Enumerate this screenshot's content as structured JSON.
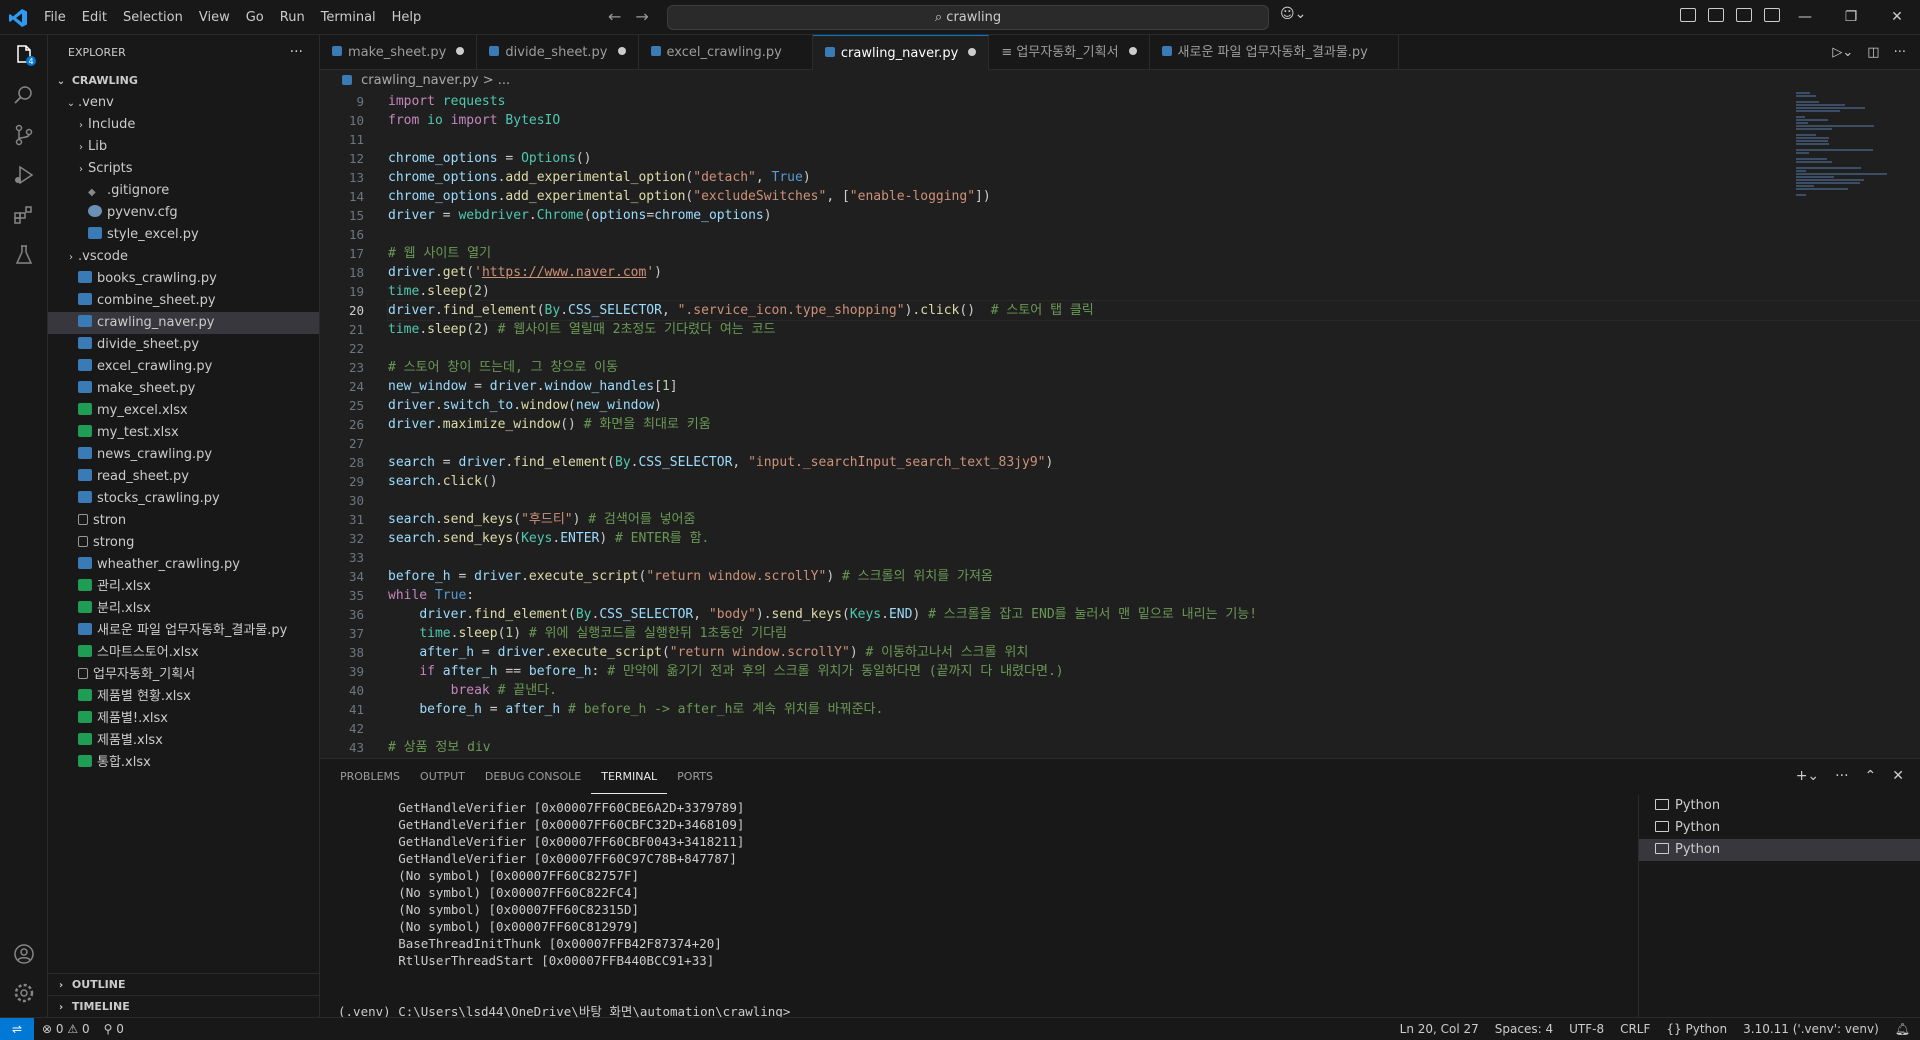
{
  "menus": [
    "File",
    "Edit",
    "Selection",
    "View",
    "Go",
    "Run",
    "Terminal",
    "Help"
  ],
  "search": {
    "text": "crawling"
  },
  "explorer": {
    "title": "EXPLORER",
    "root": "CRAWLING",
    "items": [
      {
        "label": ".venv",
        "kind": "folder-open",
        "depth": 1
      },
      {
        "label": "Include",
        "kind": "folder",
        "depth": 2
      },
      {
        "label": "Lib",
        "kind": "folder",
        "depth": 2
      },
      {
        "label": "Scripts",
        "kind": "folder",
        "depth": 2
      },
      {
        "label": ".gitignore",
        "kind": "git",
        "depth": 2
      },
      {
        "label": "pyvenv.cfg",
        "kind": "cfg",
        "depth": 2
      },
      {
        "label": "style_excel.py",
        "kind": "py",
        "depth": 2
      },
      {
        "label": ".vscode",
        "kind": "folder",
        "depth": 1
      },
      {
        "label": "books_crawling.py",
        "kind": "py",
        "depth": 1
      },
      {
        "label": "combine_sheet.py",
        "kind": "py",
        "depth": 1
      },
      {
        "label": "crawling_naver.py",
        "kind": "py",
        "depth": 1,
        "selected": true
      },
      {
        "label": "divide_sheet.py",
        "kind": "py",
        "depth": 1
      },
      {
        "label": "excel_crawling.py",
        "kind": "py",
        "depth": 1
      },
      {
        "label": "make_sheet.py",
        "kind": "py",
        "depth": 1
      },
      {
        "label": "my_excel.xlsx",
        "kind": "xl",
        "depth": 1
      },
      {
        "label": "my_test.xlsx",
        "kind": "xl",
        "depth": 1
      },
      {
        "label": "news_crawling.py",
        "kind": "py",
        "depth": 1
      },
      {
        "label": "read_sheet.py",
        "kind": "py",
        "depth": 1
      },
      {
        "label": "stocks_crawling.py",
        "kind": "py",
        "depth": 1
      },
      {
        "label": "stron",
        "kind": "txt",
        "depth": 1
      },
      {
        "label": "strong",
        "kind": "txt",
        "depth": 1
      },
      {
        "label": "wheather_crawling.py",
        "kind": "py",
        "depth": 1
      },
      {
        "label": "관리.xlsx",
        "kind": "xl",
        "depth": 1
      },
      {
        "label": "분리.xlsx",
        "kind": "xl",
        "depth": 1
      },
      {
        "label": "새로운 파일 업무자동화_결과물.py",
        "kind": "py",
        "depth": 1
      },
      {
        "label": "스마트스토어.xlsx",
        "kind": "xl",
        "depth": 1
      },
      {
        "label": "업무자동화_기획서",
        "kind": "txt",
        "depth": 1
      },
      {
        "label": "제품별 현황.xlsx",
        "kind": "xl",
        "depth": 1
      },
      {
        "label": "제품별!.xlsx",
        "kind": "xl",
        "depth": 1
      },
      {
        "label": "제품별.xlsx",
        "kind": "xl",
        "depth": 1
      },
      {
        "label": "통합.xlsx",
        "kind": "xl",
        "depth": 1
      }
    ],
    "outline": "OUTLINE",
    "timeline": "TIMELINE"
  },
  "tabs": [
    {
      "label": "make_sheet.py",
      "dirty": true
    },
    {
      "label": "divide_sheet.py",
      "dirty": true
    },
    {
      "label": "excel_crawling.py",
      "dirty": false
    },
    {
      "label": "crawling_naver.py",
      "dirty": true,
      "active": true
    },
    {
      "label": "업무자동화_기획서",
      "dirty": true,
      "plain": true
    },
    {
      "label": "새로운 파일 업무자동화_결과물.py",
      "dirty": false
    }
  ],
  "breadcrumb": {
    "file": "crawling_naver.py",
    "rest": "> ..."
  },
  "code": {
    "current_line": 20,
    "lines": [
      {
        "n": 9,
        "html": "<span class='kw'>import</span> <span class='cls'>requests</span>"
      },
      {
        "n": 10,
        "html": "<span class='kw'>from</span> <span class='cls'>io</span> <span class='kw'>import</span> <span class='cls'>BytesIO</span>"
      },
      {
        "n": 11,
        "html": ""
      },
      {
        "n": 12,
        "html": "<span class='vr'>chrome_options</span> = <span class='cls'>Options</span>()"
      },
      {
        "n": 13,
        "html": "<span class='vr'>chrome_options</span>.<span class='fn'>add_experimental_option</span>(<span class='st'>\"detach\"</span>, <span class='kb'>True</span>)"
      },
      {
        "n": 14,
        "html": "<span class='vr'>chrome_options</span>.<span class='fn'>add_experimental_option</span>(<span class='st'>\"excludeSwitches\"</span>, [<span class='st'>\"enable-logging\"</span>])"
      },
      {
        "n": 15,
        "html": "<span class='vr'>driver</span> = <span class='cls'>webdriver</span>.<span class='cls'>Chrome</span>(<span class='vr'>options</span>=<span class='vr'>chrome_options</span>)"
      },
      {
        "n": 16,
        "html": ""
      },
      {
        "n": 17,
        "html": "<span class='cm'># 웹 사이트 열기</span>"
      },
      {
        "n": 18,
        "html": "<span class='vr'>driver</span>.<span class='fn'>get</span>(<span class='st'>'<u>https://www.naver.com</u>'</span>)"
      },
      {
        "n": 19,
        "html": "<span class='cls'>time</span>.<span class='fn'>sleep</span>(<span class='nm'>2</span>)"
      },
      {
        "n": 20,
        "html": "<span class='vr'>driver</span>.<span class='fn'>find_element</span>(<span class='cls'>By</span>.<span class='vr'>CSS_SELECTOR</span>, <span class='st'>\".service_icon.type_shopping\"</span>).<span class='fn'>click</span>()  <span class='cm'># 스토어 탭 클릭</span>"
      },
      {
        "n": 21,
        "html": "<span class='cls'>time</span>.<span class='fn'>sleep</span>(<span class='nm'>2</span>) <span class='cm'># 웹사이트 열릴때 2초정도 기다렸다 여는 코드</span>"
      },
      {
        "n": 22,
        "html": ""
      },
      {
        "n": 23,
        "html": "<span class='cm'># 스토어 창이 뜨는데, 그 창으로 이동</span>"
      },
      {
        "n": 24,
        "html": "<span class='vr'>new_window</span> = <span class='vr'>driver</span>.<span class='vr'>window_handles</span>[<span class='nm'>1</span>]"
      },
      {
        "n": 25,
        "html": "<span class='vr'>driver</span>.<span class='vr'>switch_to</span>.<span class='fn'>window</span>(<span class='vr'>new_window</span>)"
      },
      {
        "n": 26,
        "html": "<span class='vr'>driver</span>.<span class='fn'>maximize_window</span>() <span class='cm'># 화면을 최대로 키움</span>"
      },
      {
        "n": 27,
        "html": ""
      },
      {
        "n": 28,
        "html": "<span class='vr'>search</span> = <span class='vr'>driver</span>.<span class='fn'>find_element</span>(<span class='cls'>By</span>.<span class='vr'>CSS_SELECTOR</span>, <span class='st'>\"input._searchInput_search_text_83jy9\"</span>)"
      },
      {
        "n": 29,
        "html": "<span class='vr'>search</span>.<span class='fn'>click</span>()"
      },
      {
        "n": 30,
        "html": ""
      },
      {
        "n": 31,
        "html": "<span class='vr'>search</span>.<span class='fn'>send_keys</span>(<span class='st'>\"후드티\"</span>) <span class='cm'># 검색어를 넣어줌</span>"
      },
      {
        "n": 32,
        "html": "<span class='vr'>search</span>.<span class='fn'>send_keys</span>(<span class='cls'>Keys</span>.<span class='vr'>ENTER</span>) <span class='cm'># ENTER를 함.</span>"
      },
      {
        "n": 33,
        "html": ""
      },
      {
        "n": 34,
        "html": "<span class='vr'>before_h</span> = <span class='vr'>driver</span>.<span class='fn'>execute_script</span>(<span class='st'>\"return window.scrollY\"</span>) <span class='cm'># 스크롤의 위치를 가져옴</span>"
      },
      {
        "n": 35,
        "html": "<span class='kw'>while</span> <span class='kb'>True</span>:"
      },
      {
        "n": 36,
        "html": "    <span class='vr'>driver</span>.<span class='fn'>find_element</span>(<span class='cls'>By</span>.<span class='vr'>CSS_SELECTOR</span>, <span class='st'>\"body\"</span>).<span class='fn'>send_keys</span>(<span class='cls'>Keys</span>.<span class='vr'>END</span>) <span class='cm'># 스크롤을 잡고 END를 눌러서 맨 밑으로 내리는 기능!</span>"
      },
      {
        "n": 37,
        "html": "    <span class='cls'>time</span>.<span class='fn'>sleep</span>(<span class='nm'>1</span>) <span class='cm'># 위에 실행코드를 실행한뒤 1초동안 기다림</span>"
      },
      {
        "n": 38,
        "html": "    <span class='vr'>after_h</span> = <span class='vr'>driver</span>.<span class='fn'>execute_script</span>(<span class='st'>\"return window.scrollY\"</span>) <span class='cm'># 이동하고나서 스크롤 위치</span>"
      },
      {
        "n": 39,
        "html": "    <span class='kw'>if</span> <span class='vr'>after_h</span> == <span class='vr'>before_h</span>: <span class='cm'># 만약에 옮기기 전과 후의 스크롤 위치가 동일하다면 (끝까지 다 내렸다면.)</span>"
      },
      {
        "n": 40,
        "html": "        <span class='kw'>break</span> <span class='cm'># 끝낸다.</span>"
      },
      {
        "n": 41,
        "html": "    <span class='vr'>before_h</span> = <span class='vr'>after_h</span> <span class='cm'># before_h -> after_h로 계속 위치를 바꿔준다.</span>"
      },
      {
        "n": 42,
        "html": ""
      },
      {
        "n": 43,
        "html": "<span class='cm'># 상품 정보 div</span>"
      }
    ]
  },
  "panel": {
    "tabs": [
      "PROBLEMS",
      "OUTPUT",
      "DEBUG CONSOLE",
      "TERMINAL",
      "PORTS"
    ],
    "active": "TERMINAL",
    "terminal_lines": [
      "        GetHandleVerifier [0x00007FF60CBE6A2D+3379789]",
      "        GetHandleVerifier [0x00007FF60CBFC32D+3468109]",
      "        GetHandleVerifier [0x00007FF60CBF0043+3418211]",
      "        GetHandleVerifier [0x00007FF60C97C78B+847787]",
      "        (No symbol) [0x00007FF60C82757F]",
      "        (No symbol) [0x00007FF60C822FC4]",
      "        (No symbol) [0x00007FF60C82315D]",
      "        (No symbol) [0x00007FF60C812979]",
      "        BaseThreadInitThunk [0x00007FFB42F87374+20]",
      "        RtlUserThreadStart [0x00007FFB440BCC91+33]",
      "",
      "",
      "(.venv) C:\\Users\\lsd44\\OneDrive\\바탕 화면\\automation\\crawling>"
    ],
    "terminals": [
      "Python",
      "Python",
      "Python"
    ]
  },
  "status": {
    "errors": "0",
    "warnings": "0",
    "ports": "0",
    "position": "Ln 20, Col 27",
    "spaces": "Spaces: 4",
    "encoding": "UTF-8",
    "eol": "CRLF",
    "language": "Python",
    "interpreter": "3.10.11 ('.venv': venv)"
  },
  "colors": {
    "accent": "#0078d4",
    "background": "#1f1f1f",
    "sidebar": "#181818"
  }
}
